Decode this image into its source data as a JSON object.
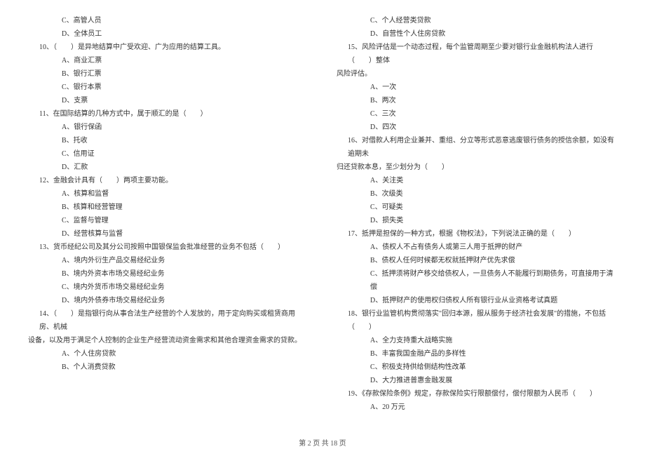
{
  "left": {
    "pre_options": [
      "C、高管人员",
      "D、全体员工"
    ],
    "items": [
      {
        "q": "10、（　　）是异地结算中广受欢迎、广为应用的结算工具。",
        "opts": [
          "A、商业汇票",
          "B、银行汇票",
          "C、银行本票",
          "D、支票"
        ]
      },
      {
        "q": "11、在国际结算的几种方式中，属于顺汇的是（　　）",
        "opts": [
          "A、银行保函",
          "B、托收",
          "C、信用证",
          "D、汇款"
        ]
      },
      {
        "q": "12、金融会计具有（　　）两项主要功能。",
        "opts": [
          "A、核算和监督",
          "B、核算和经营管理",
          "C、监督与管理",
          "D、经营核算与监督"
        ]
      },
      {
        "q": "13、货币经纪公司及其分公司按照中国银保监会批准经营的业务不包括（　　）",
        "opts": [
          "A、境内外衍生产品交易经纪业务",
          "B、境内外资本市场交易经纪业务",
          "C、境内外货币市场交易经纪业务",
          "D、境内外债券市场交易经纪业务"
        ]
      },
      {
        "q": "14、（　　）是指银行向从事合法生产经营的个人发放的，用于定向购买或租赁商用房、机械",
        "q2": "设备，以及用于满足个人控制的企业生产经营流动资金需求和其他合理资金需求的贷款。",
        "opts": [
          "A、个人住房贷款",
          "B、个人消费贷款"
        ]
      }
    ]
  },
  "right": {
    "pre_options": [
      "C、个人经营类贷款",
      "D、自营性个人住房贷款"
    ],
    "items": [
      {
        "q": "15、风险评估是一个动态过程，每个监管周期至少要对银行业金融机构法人进行（　　）整体",
        "q2": "风险评估。",
        "opts": [
          "A、一次",
          "B、两次",
          "C、三次",
          "D、四次"
        ]
      },
      {
        "q": "16、对借款人利用企业兼并、重组、分立等形式恶意逃废银行债务的授信余额，如没有逾期未",
        "q2": "归还贷款本息，至少划分为（　　）",
        "opts": [
          "A、关注类",
          "B、次级类",
          "C、可疑类",
          "D、损失类"
        ]
      },
      {
        "q": "17、抵押是担保的一种方式，根据《物权法》，下列说法正确的是（　　）",
        "opts": [
          "A、债权人不占有债务人或第三人用于抵押的财产",
          "B、债权人任何时候都无权就抵押财产优先求偿",
          "C、抵押须将财产移交给债权人，一旦债务人不能履行到期债务，可直接用于清偿",
          "D、抵押财产的使用权归债权人所有银行业从业资格考试真题"
        ]
      },
      {
        "q": "18、银行业监管机构贯彻落实\"回归本源，服从服务于经济社会发展\"的措施，不包括（　　）",
        "opts": [
          "A、全力支持重大战略实施",
          "B、丰富我国金融产品的多样性",
          "C、积极支持供给侧结构性改革",
          "D、大力推进普惠金融发展"
        ]
      },
      {
        "q": "19、《存款保险条例》规定，存款保险实行限额偿付，偿付限额为人民币（　　）",
        "opts": [
          "A、20 万元"
        ]
      }
    ]
  },
  "footer": "第 2 页 共 18 页"
}
